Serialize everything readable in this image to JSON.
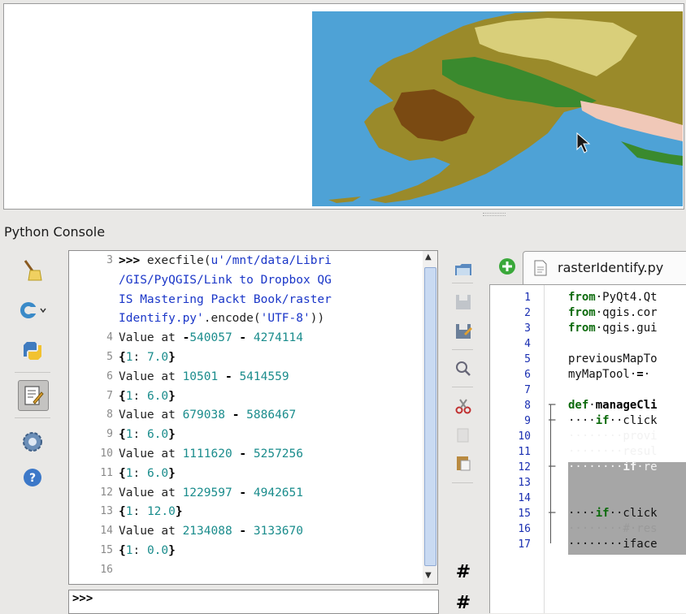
{
  "console": {
    "title": "Python Console",
    "input_prompt": ">>>",
    "lines": [
      {
        "n": "3",
        "parts": [
          {
            "t": ">>> ",
            "c": "bk"
          },
          {
            "t": "execfile(",
            "c": ""
          },
          {
            "t": "u'/mnt/data/Libri",
            "c": "bl"
          }
        ]
      },
      {
        "n": "",
        "parts": [
          {
            "t": "/GIS/PyQGIS/Link to Dropbox QG",
            "c": "bl"
          }
        ]
      },
      {
        "n": "",
        "parts": [
          {
            "t": "IS Mastering Packt Book/raster",
            "c": "bl"
          }
        ]
      },
      {
        "n": "",
        "parts": [
          {
            "t": "Identify.py'",
            "c": "bl"
          },
          {
            "t": ".encode(",
            "c": ""
          },
          {
            "t": "'UTF-8'",
            "c": "bl"
          },
          {
            "t": "))",
            "c": ""
          }
        ]
      },
      {
        "n": "4",
        "parts": [
          {
            "t": "Value at ",
            "c": ""
          },
          {
            "t": "-",
            "c": "bk"
          },
          {
            "t": "540057",
            "c": "gr"
          },
          {
            "t": " - ",
            "c": "bk"
          },
          {
            "t": "4274114",
            "c": "gr"
          }
        ]
      },
      {
        "n": "5",
        "parts": [
          {
            "t": "{",
            "c": "bk"
          },
          {
            "t": "1",
            "c": "gr"
          },
          {
            "t": ": ",
            "c": ""
          },
          {
            "t": "7.0",
            "c": "gr"
          },
          {
            "t": "}",
            "c": "bk"
          }
        ]
      },
      {
        "n": "6",
        "parts": [
          {
            "t": "Value at ",
            "c": ""
          },
          {
            "t": "10501",
            "c": "gr"
          },
          {
            "t": " - ",
            "c": "bk"
          },
          {
            "t": "5414559",
            "c": "gr"
          }
        ]
      },
      {
        "n": "7",
        "parts": [
          {
            "t": "{",
            "c": "bk"
          },
          {
            "t": "1",
            "c": "gr"
          },
          {
            "t": ": ",
            "c": ""
          },
          {
            "t": "6.0",
            "c": "gr"
          },
          {
            "t": "}",
            "c": "bk"
          }
        ]
      },
      {
        "n": "8",
        "parts": [
          {
            "t": "Value at ",
            "c": ""
          },
          {
            "t": "679038",
            "c": "gr"
          },
          {
            "t": " - ",
            "c": "bk"
          },
          {
            "t": "5886467",
            "c": "gr"
          }
        ]
      },
      {
        "n": "9",
        "parts": [
          {
            "t": "{",
            "c": "bk"
          },
          {
            "t": "1",
            "c": "gr"
          },
          {
            "t": ": ",
            "c": ""
          },
          {
            "t": "6.0",
            "c": "gr"
          },
          {
            "t": "}",
            "c": "bk"
          }
        ]
      },
      {
        "n": "10",
        "parts": [
          {
            "t": "Value at ",
            "c": ""
          },
          {
            "t": "1111620",
            "c": "gr"
          },
          {
            "t": " - ",
            "c": "bk"
          },
          {
            "t": "5257256",
            "c": "gr"
          }
        ]
      },
      {
        "n": "11",
        "parts": [
          {
            "t": "{",
            "c": "bk"
          },
          {
            "t": "1",
            "c": "gr"
          },
          {
            "t": ": ",
            "c": ""
          },
          {
            "t": "6.0",
            "c": "gr"
          },
          {
            "t": "}",
            "c": "bk"
          }
        ]
      },
      {
        "n": "12",
        "parts": [
          {
            "t": "Value at ",
            "c": ""
          },
          {
            "t": "1229597",
            "c": "gr"
          },
          {
            "t": " - ",
            "c": "bk"
          },
          {
            "t": "4942651",
            "c": "gr"
          }
        ]
      },
      {
        "n": "13",
        "parts": [
          {
            "t": "{",
            "c": "bk"
          },
          {
            "t": "1",
            "c": "gr"
          },
          {
            "t": ": ",
            "c": ""
          },
          {
            "t": "12.0",
            "c": "gr"
          },
          {
            "t": "}",
            "c": "bk"
          }
        ]
      },
      {
        "n": "14",
        "parts": [
          {
            "t": "Value at ",
            "c": ""
          },
          {
            "t": "2134088",
            "c": "gr"
          },
          {
            "t": " - ",
            "c": "bk"
          },
          {
            "t": "3133670",
            "c": "gr"
          }
        ]
      },
      {
        "n": "15",
        "parts": [
          {
            "t": "{",
            "c": "bk"
          },
          {
            "t": "1",
            "c": "gr"
          },
          {
            "t": ": ",
            "c": ""
          },
          {
            "t": "0.0",
            "c": "gr"
          },
          {
            "t": "}",
            "c": "bk"
          }
        ]
      },
      {
        "n": "16",
        "parts": []
      }
    ]
  },
  "left_toolbar": [
    {
      "name": "clear-console-icon",
      "active": false
    },
    {
      "name": "import-class-icon",
      "active": false
    },
    {
      "name": "run-command-icon",
      "active": false
    },
    {
      "name": "show-editor-icon",
      "active": true
    },
    {
      "name": "settings-icon",
      "active": false
    },
    {
      "name": "help-icon",
      "active": false
    }
  ],
  "editor": {
    "tab_label": "rasterIdentify.py",
    "lines": [
      {
        "n": "1",
        "parts": [
          {
            "t": "from",
            "c": "kw"
          },
          {
            "t": "·PyQt4.Qt",
            "c": ""
          }
        ]
      },
      {
        "n": "2",
        "parts": [
          {
            "t": "from",
            "c": "kw"
          },
          {
            "t": "·qgis.cor",
            "c": ""
          }
        ]
      },
      {
        "n": "3",
        "parts": [
          {
            "t": "from",
            "c": "kw"
          },
          {
            "t": "·qgis.gui",
            "c": ""
          }
        ]
      },
      {
        "n": "4",
        "parts": []
      },
      {
        "n": "5",
        "parts": [
          {
            "t": "previousMapTo",
            "c": ""
          }
        ]
      },
      {
        "n": "6",
        "parts": [
          {
            "t": "myMapTool·",
            "c": ""
          },
          {
            "t": "=",
            "c": "bk"
          },
          {
            "t": "·",
            "c": ""
          }
        ]
      },
      {
        "n": "7",
        "parts": []
      },
      {
        "n": "8",
        "parts": [
          {
            "t": "def",
            "c": "kw"
          },
          {
            "t": "·",
            "c": ""
          },
          {
            "t": "manageCli",
            "c": "fn"
          }
        ]
      },
      {
        "n": "9",
        "parts": [
          {
            "t": "····",
            "c": ""
          },
          {
            "t": "if",
            "c": "kw"
          },
          {
            "t": "··click",
            "c": ""
          }
        ]
      },
      {
        "n": "10",
        "parts": [
          {
            "t": "········provi",
            "c": ""
          }
        ]
      },
      {
        "n": "11",
        "parts": [
          {
            "t": "········resul",
            "c": ""
          }
        ]
      },
      {
        "n": "12",
        "parts": [
          {
            "t": "········",
            "c": ""
          },
          {
            "t": "if",
            "c": "kw"
          },
          {
            "t": "·re",
            "c": ""
          }
        ]
      },
      {
        "n": "13",
        "parts": [
          {
            "t": "",
            "c": ""
          }
        ]
      },
      {
        "n": "14",
        "parts": [
          {
            "t": "",
            "c": ""
          }
        ]
      },
      {
        "n": "15",
        "parts": [
          {
            "t": "····",
            "c": ""
          },
          {
            "t": "if",
            "c": "kw"
          },
          {
            "t": "··click",
            "c": ""
          }
        ]
      },
      {
        "n": "16",
        "parts": [
          {
            "t": "········#·res",
            "c": "cm"
          }
        ]
      },
      {
        "n": "17",
        "parts": [
          {
            "t": "········iface",
            "c": ""
          }
        ]
      }
    ]
  },
  "editor_toolbar": [
    {
      "name": "open-file-icon"
    },
    {
      "name": "save-icon"
    },
    {
      "name": "save-as-icon"
    },
    {
      "name": "find-icon"
    },
    {
      "name": "cut-icon"
    },
    {
      "name": "copy-icon"
    },
    {
      "name": "paste-icon"
    },
    {
      "name": "comment-icon"
    },
    {
      "name": "uncomment-icon"
    }
  ]
}
